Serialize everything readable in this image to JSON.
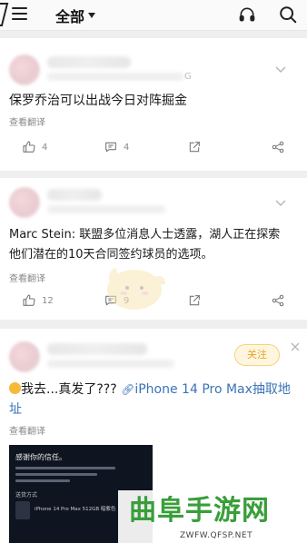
{
  "header": {
    "feed_label": "全部",
    "icons": [
      "menu-icon",
      "headphone-icon",
      "search-icon"
    ]
  },
  "posts": [
    {
      "author": "",
      "meta_tail": "G",
      "text": "保罗乔治可以出战今日对阵掘金",
      "translate_label": "查看翻译",
      "likes": "4",
      "comments": "4"
    },
    {
      "author": "",
      "text_line1": "Marc Stein: 联盟多位消息人士透露，湖人正在探索",
      "text_line2": "他们潜在的10天合同签约球员的选项。",
      "translate_label": "查看翻译",
      "likes": "12",
      "comments": "9"
    },
    {
      "author": "",
      "follow_label": "关注",
      "text_prefix": "我去...真发了???",
      "link_text_line1": "iPhone 14 Pro Max抽取地",
      "link_text_line2": "址",
      "translate_label": "查看翻译",
      "image": {
        "title": "感谢你的信任。",
        "section_label": "送货方式",
        "product": "iPhone 14 Pro Max 512GB 暗紫色"
      }
    }
  ],
  "watermark": {
    "title": "曲阜手游网",
    "url": "ZWFW.QFSP.NET"
  }
}
